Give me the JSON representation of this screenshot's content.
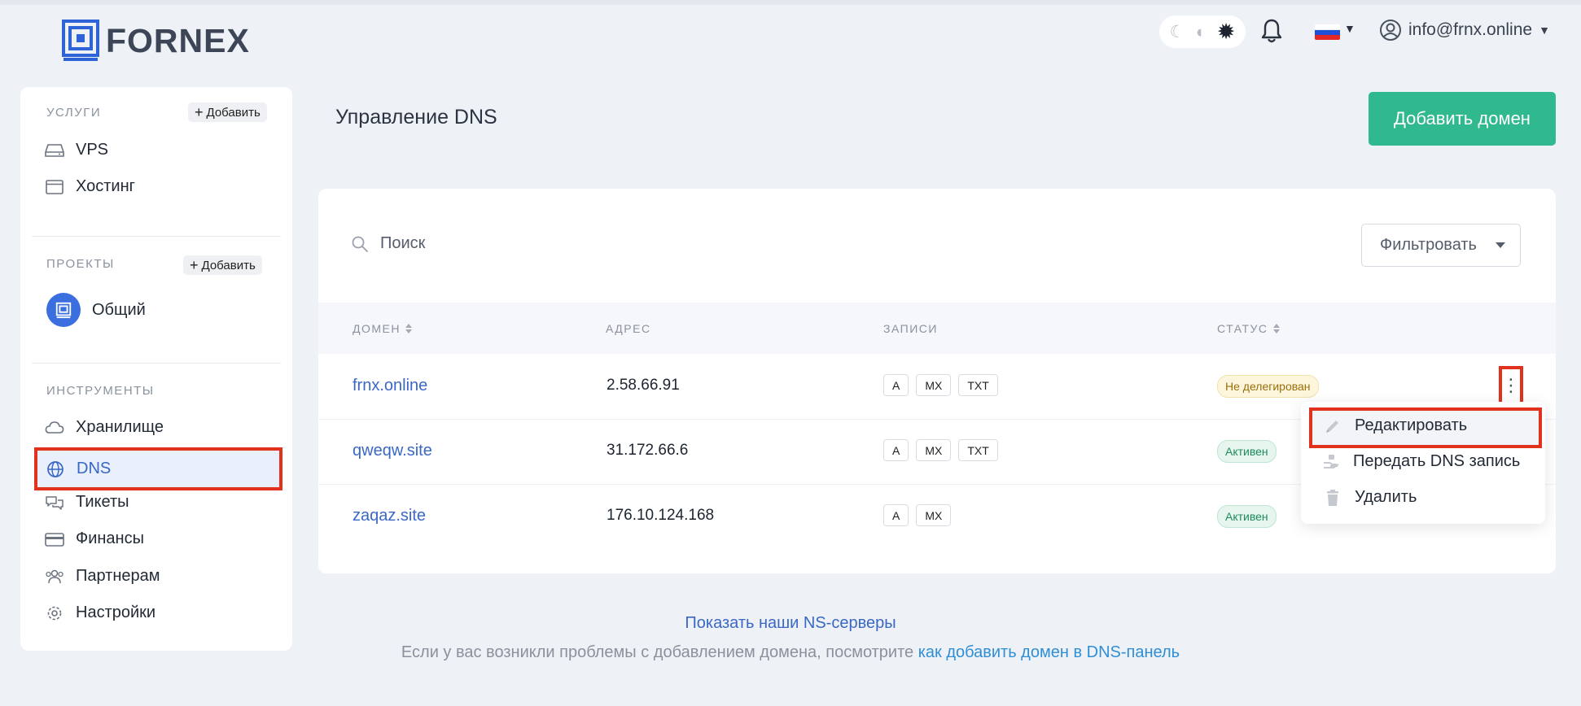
{
  "brand": {
    "name": "FORNEX"
  },
  "header": {
    "theme_icons": [
      "moon-icon",
      "half-moon-icon",
      "sun-icon"
    ],
    "active_theme": "sun-icon",
    "language": "ru",
    "user_email": "info@frnx.online"
  },
  "sidebar": {
    "services": {
      "title": "УСЛУГИ",
      "add_label": "Добавить",
      "items": [
        {
          "label": "VPS",
          "icon": "server-icon"
        },
        {
          "label": "Хостинг",
          "icon": "browser-window-icon"
        }
      ]
    },
    "projects": {
      "title": "ПРОЕКТЫ",
      "add_label": "Добавить",
      "items": [
        {
          "label": "Общий",
          "icon": "fornex-logo-icon"
        }
      ]
    },
    "tools": {
      "title": "ИНСТРУМЕНТЫ",
      "items": [
        {
          "label": "Хранилище",
          "icon": "cloud-icon"
        },
        {
          "label": "DNS",
          "icon": "globe-icon",
          "active": true
        },
        {
          "label": "Тикеты",
          "icon": "chat-bubbles-icon"
        },
        {
          "label": "Финансы",
          "icon": "credit-card-icon"
        },
        {
          "label": "Партнерам",
          "icon": "users-icon"
        },
        {
          "label": "Настройки",
          "icon": "gear-icon"
        }
      ]
    }
  },
  "main": {
    "title": "Управление DNS",
    "add_domain_label": "Добавить домен",
    "search_placeholder": "Поиск",
    "filter_label": "Фильтровать",
    "columns": {
      "domain": "ДОМЕН",
      "address": "АДРЕС",
      "records": "ЗАПИСИ",
      "status": "СТАТУС"
    },
    "rows": [
      {
        "domain": "frnx.online",
        "address": "2.58.66.91",
        "records": [
          "A",
          "MX",
          "TXT"
        ],
        "status": "Не делегирован",
        "status_type": "warning"
      },
      {
        "domain": "qweqw.site",
        "address": "31.172.66.6",
        "records": [
          "A",
          "MX",
          "TXT"
        ],
        "status": "Активен",
        "status_type": "success"
      },
      {
        "domain": "zaqaz.site",
        "address": "176.10.124.168",
        "records": [
          "A",
          "MX"
        ],
        "status": "Активен",
        "status_type": "success"
      }
    ],
    "context_menu": {
      "items": [
        {
          "label": "Редактировать",
          "icon": "pencil-icon"
        },
        {
          "label": "Передать DNS запись",
          "icon": "hand-transfer-icon"
        },
        {
          "label": "Удалить",
          "icon": "trash-icon"
        }
      ]
    }
  },
  "footer": {
    "ns_link": "Показать наши NS-серверы",
    "help_text": "Если у вас возникли проблемы с добавлением домена, посмотрите",
    "help_link": "как добавить домен в DNS-панель"
  },
  "colors": {
    "accent_green": "#30b88f",
    "link_blue": "#3a68c4",
    "highlight_red": "#e0321c",
    "background": "#eef1f6"
  }
}
